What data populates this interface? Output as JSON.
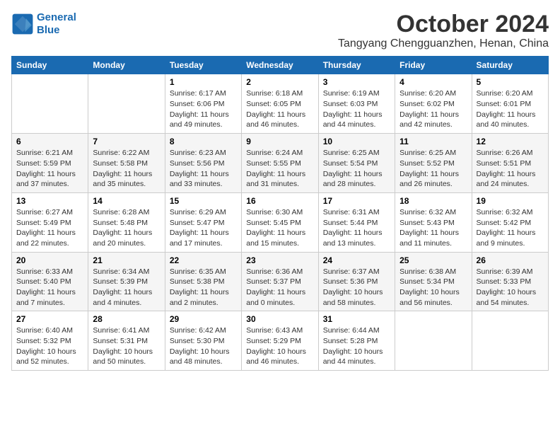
{
  "logo": {
    "line1": "General",
    "line2": "Blue"
  },
  "title": "October 2024",
  "subtitle": "Tangyang Chengguanzhen, Henan, China",
  "days_of_week": [
    "Sunday",
    "Monday",
    "Tuesday",
    "Wednesday",
    "Thursday",
    "Friday",
    "Saturday"
  ],
  "weeks": [
    [
      {
        "day": "",
        "sunrise": "",
        "sunset": "",
        "daylight": ""
      },
      {
        "day": "",
        "sunrise": "",
        "sunset": "",
        "daylight": ""
      },
      {
        "day": "1",
        "sunrise": "Sunrise: 6:17 AM",
        "sunset": "Sunset: 6:06 PM",
        "daylight": "Daylight: 11 hours and 49 minutes."
      },
      {
        "day": "2",
        "sunrise": "Sunrise: 6:18 AM",
        "sunset": "Sunset: 6:05 PM",
        "daylight": "Daylight: 11 hours and 46 minutes."
      },
      {
        "day": "3",
        "sunrise": "Sunrise: 6:19 AM",
        "sunset": "Sunset: 6:03 PM",
        "daylight": "Daylight: 11 hours and 44 minutes."
      },
      {
        "day": "4",
        "sunrise": "Sunrise: 6:20 AM",
        "sunset": "Sunset: 6:02 PM",
        "daylight": "Daylight: 11 hours and 42 minutes."
      },
      {
        "day": "5",
        "sunrise": "Sunrise: 6:20 AM",
        "sunset": "Sunset: 6:01 PM",
        "daylight": "Daylight: 11 hours and 40 minutes."
      }
    ],
    [
      {
        "day": "6",
        "sunrise": "Sunrise: 6:21 AM",
        "sunset": "Sunset: 5:59 PM",
        "daylight": "Daylight: 11 hours and 37 minutes."
      },
      {
        "day": "7",
        "sunrise": "Sunrise: 6:22 AM",
        "sunset": "Sunset: 5:58 PM",
        "daylight": "Daylight: 11 hours and 35 minutes."
      },
      {
        "day": "8",
        "sunrise": "Sunrise: 6:23 AM",
        "sunset": "Sunset: 5:56 PM",
        "daylight": "Daylight: 11 hours and 33 minutes."
      },
      {
        "day": "9",
        "sunrise": "Sunrise: 6:24 AM",
        "sunset": "Sunset: 5:55 PM",
        "daylight": "Daylight: 11 hours and 31 minutes."
      },
      {
        "day": "10",
        "sunrise": "Sunrise: 6:25 AM",
        "sunset": "Sunset: 5:54 PM",
        "daylight": "Daylight: 11 hours and 28 minutes."
      },
      {
        "day": "11",
        "sunrise": "Sunrise: 6:25 AM",
        "sunset": "Sunset: 5:52 PM",
        "daylight": "Daylight: 11 hours and 26 minutes."
      },
      {
        "day": "12",
        "sunrise": "Sunrise: 6:26 AM",
        "sunset": "Sunset: 5:51 PM",
        "daylight": "Daylight: 11 hours and 24 minutes."
      }
    ],
    [
      {
        "day": "13",
        "sunrise": "Sunrise: 6:27 AM",
        "sunset": "Sunset: 5:49 PM",
        "daylight": "Daylight: 11 hours and 22 minutes."
      },
      {
        "day": "14",
        "sunrise": "Sunrise: 6:28 AM",
        "sunset": "Sunset: 5:48 PM",
        "daylight": "Daylight: 11 hours and 20 minutes."
      },
      {
        "day": "15",
        "sunrise": "Sunrise: 6:29 AM",
        "sunset": "Sunset: 5:47 PM",
        "daylight": "Daylight: 11 hours and 17 minutes."
      },
      {
        "day": "16",
        "sunrise": "Sunrise: 6:30 AM",
        "sunset": "Sunset: 5:45 PM",
        "daylight": "Daylight: 11 hours and 15 minutes."
      },
      {
        "day": "17",
        "sunrise": "Sunrise: 6:31 AM",
        "sunset": "Sunset: 5:44 PM",
        "daylight": "Daylight: 11 hours and 13 minutes."
      },
      {
        "day": "18",
        "sunrise": "Sunrise: 6:32 AM",
        "sunset": "Sunset: 5:43 PM",
        "daylight": "Daylight: 11 hours and 11 minutes."
      },
      {
        "day": "19",
        "sunrise": "Sunrise: 6:32 AM",
        "sunset": "Sunset: 5:42 PM",
        "daylight": "Daylight: 11 hours and 9 minutes."
      }
    ],
    [
      {
        "day": "20",
        "sunrise": "Sunrise: 6:33 AM",
        "sunset": "Sunset: 5:40 PM",
        "daylight": "Daylight: 11 hours and 7 minutes."
      },
      {
        "day": "21",
        "sunrise": "Sunrise: 6:34 AM",
        "sunset": "Sunset: 5:39 PM",
        "daylight": "Daylight: 11 hours and 4 minutes."
      },
      {
        "day": "22",
        "sunrise": "Sunrise: 6:35 AM",
        "sunset": "Sunset: 5:38 PM",
        "daylight": "Daylight: 11 hours and 2 minutes."
      },
      {
        "day": "23",
        "sunrise": "Sunrise: 6:36 AM",
        "sunset": "Sunset: 5:37 PM",
        "daylight": "Daylight: 11 hours and 0 minutes."
      },
      {
        "day": "24",
        "sunrise": "Sunrise: 6:37 AM",
        "sunset": "Sunset: 5:36 PM",
        "daylight": "Daylight: 10 hours and 58 minutes."
      },
      {
        "day": "25",
        "sunrise": "Sunrise: 6:38 AM",
        "sunset": "Sunset: 5:34 PM",
        "daylight": "Daylight: 10 hours and 56 minutes."
      },
      {
        "day": "26",
        "sunrise": "Sunrise: 6:39 AM",
        "sunset": "Sunset: 5:33 PM",
        "daylight": "Daylight: 10 hours and 54 minutes."
      }
    ],
    [
      {
        "day": "27",
        "sunrise": "Sunrise: 6:40 AM",
        "sunset": "Sunset: 5:32 PM",
        "daylight": "Daylight: 10 hours and 52 minutes."
      },
      {
        "day": "28",
        "sunrise": "Sunrise: 6:41 AM",
        "sunset": "Sunset: 5:31 PM",
        "daylight": "Daylight: 10 hours and 50 minutes."
      },
      {
        "day": "29",
        "sunrise": "Sunrise: 6:42 AM",
        "sunset": "Sunset: 5:30 PM",
        "daylight": "Daylight: 10 hours and 48 minutes."
      },
      {
        "day": "30",
        "sunrise": "Sunrise: 6:43 AM",
        "sunset": "Sunset: 5:29 PM",
        "daylight": "Daylight: 10 hours and 46 minutes."
      },
      {
        "day": "31",
        "sunrise": "Sunrise: 6:44 AM",
        "sunset": "Sunset: 5:28 PM",
        "daylight": "Daylight: 10 hours and 44 minutes."
      },
      {
        "day": "",
        "sunrise": "",
        "sunset": "",
        "daylight": ""
      },
      {
        "day": "",
        "sunrise": "",
        "sunset": "",
        "daylight": ""
      }
    ]
  ]
}
